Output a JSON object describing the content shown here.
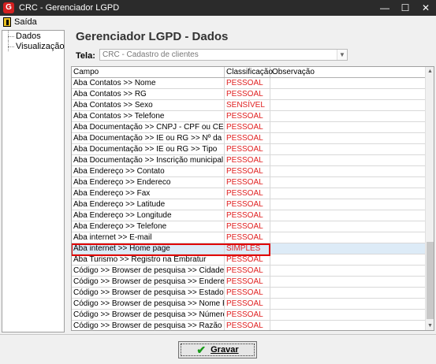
{
  "window": {
    "title": "CRC - Gerenciador LGPD",
    "app_icon": "G"
  },
  "menu": {
    "exit_label": "Saída"
  },
  "nav": {
    "items": [
      "Dados",
      "Visualização"
    ]
  },
  "main": {
    "heading": "Gerenciador LGPD - Dados",
    "tela_label": "Tela:",
    "tela_value": "CRC - Cadastro de clientes",
    "columns": [
      "Campo",
      "Classificação",
      "Observação"
    ],
    "rows": [
      [
        "Aba Contatos >> Nome",
        "PESSOAL",
        ""
      ],
      [
        "Aba Contatos >> RG",
        "PESSOAL",
        ""
      ],
      [
        "Aba Contatos >> Sexo",
        "SENSÍVEL",
        ""
      ],
      [
        "Aba Contatos >> Telefone",
        "PESSOAL",
        ""
      ],
      [
        "Aba Documentação >> CNPJ - CPF ou CEI",
        "PESSOAL",
        ""
      ],
      [
        "Aba Documentação >> IE ou RG >> Nº da inscrição",
        "PESSOAL",
        ""
      ],
      [
        "Aba Documentação >> IE ou RG >> Tipo",
        "PESSOAL",
        ""
      ],
      [
        "Aba Documentação >> Inscrição municipal",
        "PESSOAL",
        ""
      ],
      [
        "Aba Endereço >> Contato",
        "PESSOAL",
        ""
      ],
      [
        "Aba Endereço >> Endereco",
        "PESSOAL",
        ""
      ],
      [
        "Aba Endereço >> Fax",
        "PESSOAL",
        ""
      ],
      [
        "Aba Endereço >> Latitude",
        "PESSOAL",
        ""
      ],
      [
        "Aba Endereço >> Longitude",
        "PESSOAL",
        ""
      ],
      [
        "Aba Endereço >> Telefone",
        "PESSOAL",
        ""
      ],
      [
        "Aba internet >> E-mail",
        "PESSOAL",
        ""
      ],
      [
        "Aba internet >> Home page",
        "SIMPLES",
        ""
      ],
      [
        "Aba Turismo >> Registro na Embratur",
        "PESSOAL",
        ""
      ],
      [
        "Código >> Browser de pesquisa >> Cidade",
        "PESSOAL",
        ""
      ],
      [
        "Código >> Browser de pesquisa >> Endereço",
        "PESSOAL",
        ""
      ],
      [
        "Código >> Browser de pesquisa >> Estado",
        "PESSOAL",
        ""
      ],
      [
        "Código >> Browser de pesquisa >> Nome Fantasia",
        "PESSOAL",
        ""
      ],
      [
        "Código >> Browser de pesquisa >> Número",
        "PESSOAL",
        ""
      ],
      [
        "Código >> Browser de pesquisa >> Razão Social",
        "PESSOAL",
        ""
      ]
    ],
    "selected_row": 15
  },
  "footer": {
    "save_label": "Gravar"
  },
  "colors": {
    "classification": "#e02020",
    "titlebar": "#2b2b2b",
    "selection_outline": "#e00000"
  }
}
